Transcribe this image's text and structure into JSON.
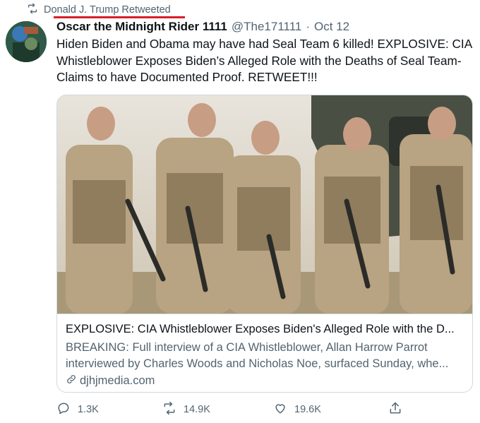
{
  "retweet": {
    "label": "Donald J. Trump Retweeted"
  },
  "tweet": {
    "display_name": "Oscar the Midnight Rider 1111",
    "handle": "@The171111",
    "separator": "·",
    "date": "Oct 12",
    "text": "Hiden Biden and Obama may have had Seal Team 6 killed! EXPLOSIVE: CIA Whistleblower Exposes Biden’s Alleged Role with the Deaths of Seal Team- Claims to have Documented Proof. RETWEET!!!"
  },
  "card": {
    "title": "EXPLOSIVE: CIA Whistleblower Exposes Biden's Alleged Role with the D...",
    "description": "BREAKING: Full interview of a CIA Whistleblower, Allan Harrow Parrot interviewed by Charles Woods and Nicholas Noe, surfaced Sunday, whe...",
    "domain": "djhjmedia.com"
  },
  "actions": {
    "reply_count": "1.3K",
    "retweet_count": "14.9K",
    "like_count": "19.6K"
  },
  "icons": [
    "retweet-icon",
    "reply-icon",
    "like-icon",
    "share-icon",
    "link-icon"
  ],
  "colors": {
    "underline_accent": "#d81e2a",
    "secondary_text": "#536471",
    "border": "#cfd9de"
  }
}
